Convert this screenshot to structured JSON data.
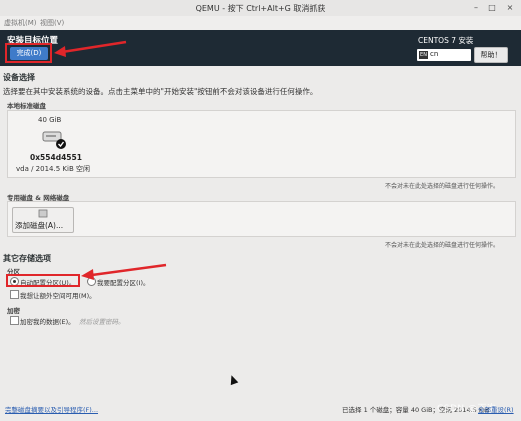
{
  "qemu": {
    "title": "QEMU - 按下 Ctrl+Alt+G 取消抓获",
    "min": "–",
    "max": "□",
    "close": "×"
  },
  "menu": [
    "虚拟机(M)",
    "视图(V)"
  ],
  "header": {
    "title": "安装目标位置",
    "done_label": "完成(D)",
    "product": "CENTOS 7 安装",
    "kb_icon": "EN",
    "kb_value": "cn",
    "help_label": "帮助！"
  },
  "device": {
    "heading": "设备选择",
    "description": "选择要在其中安装系统的设备。点击主菜单中的\"开始安装\"按钮前不会对该设备进行任何操作。",
    "local_heading": "本地标准磁盘",
    "disk": {
      "size": "40 GiB",
      "id": "0x554d4551",
      "info": "vda  /  2014.5 KiB 空闲"
    },
    "local_note": "不会对未在此处选择的磁盘进行任何操作。",
    "special_heading": "专用磁盘 & 网络磁盘",
    "add_disk_label": "添加磁盘(A)...",
    "special_note": "不会对未在此处选择的磁盘进行任何操作。"
  },
  "storage": {
    "heading": "其它存储选项",
    "partition_heading": "分区",
    "auto_label": "自动配置分区(U)。",
    "manual_label": "我要配置分区(I)。",
    "extra_space_label": "我想让额外空间可用(M)。",
    "encrypt_heading": "加密",
    "encrypt_label": "加密我的数据(E)。",
    "encrypt_hint": "然后设置密码。"
  },
  "footer": {
    "link": "完整磁盘摘要以及引导程序(F)...",
    "summary": "已选择 1 个磁盘；容量 40 GiB；空闲 2014.5 KiB",
    "watermark": "CSDN @下次",
    "reset": "全部重设(R)"
  }
}
